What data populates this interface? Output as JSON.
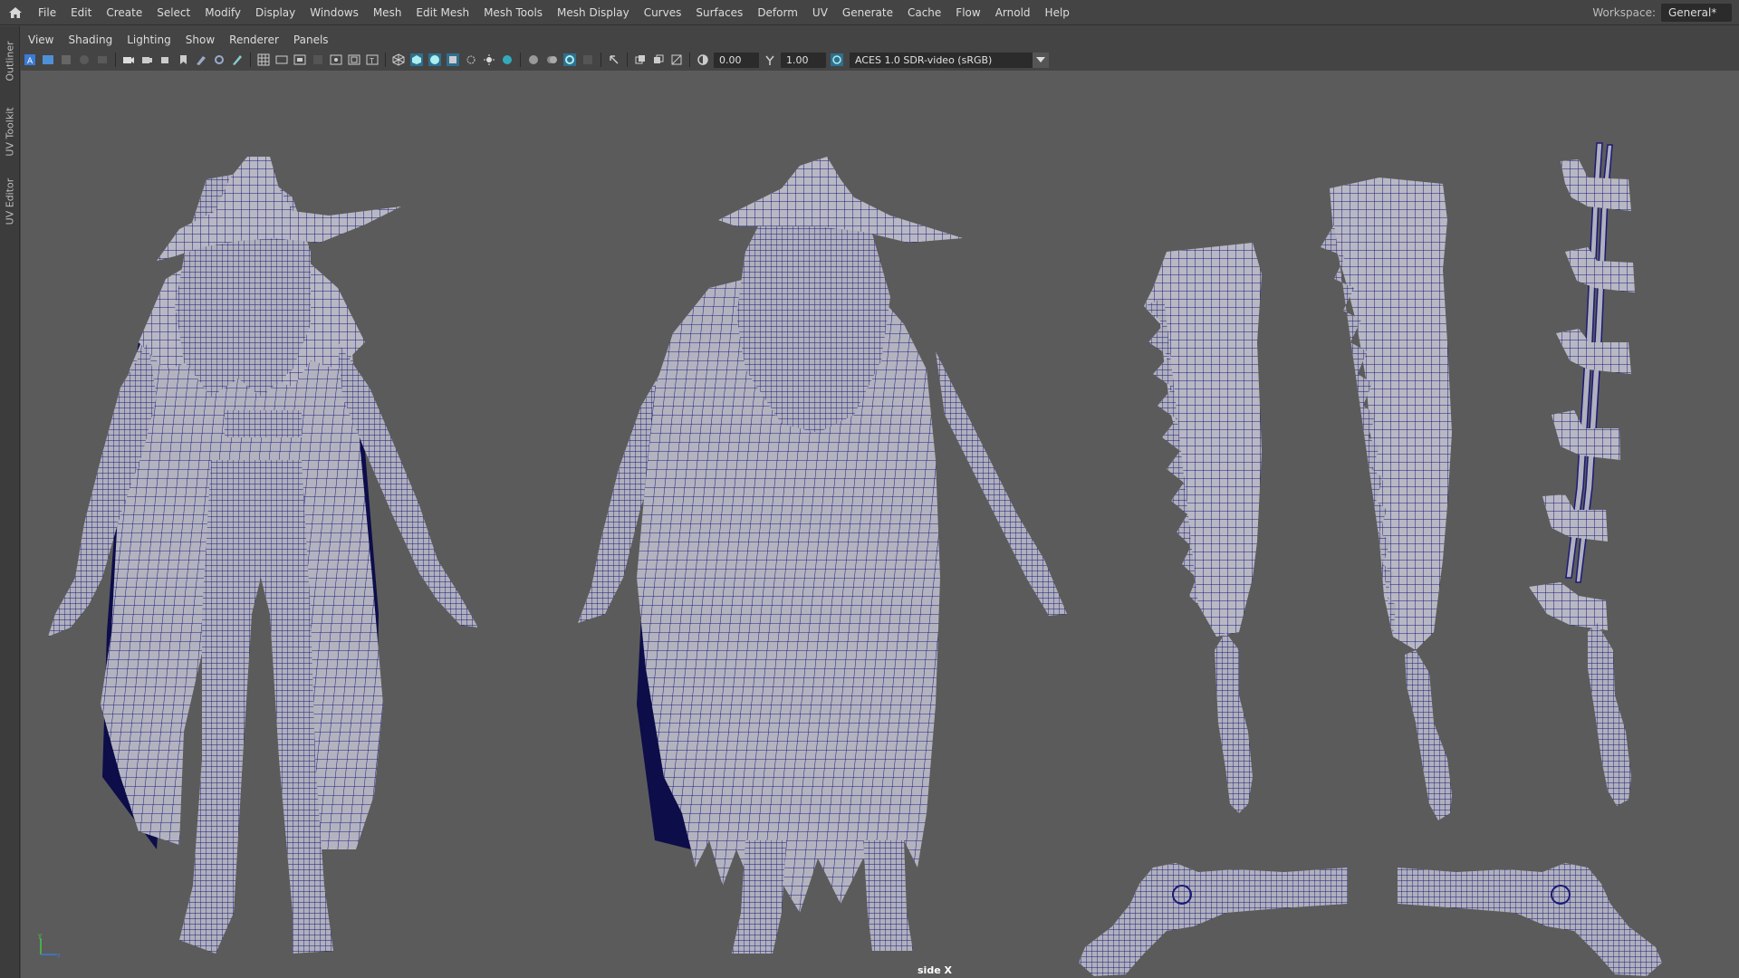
{
  "menubar": {
    "items": [
      "File",
      "Edit",
      "Create",
      "Select",
      "Modify",
      "Display",
      "Windows",
      "Mesh",
      "Edit Mesh",
      "Mesh Tools",
      "Mesh Display",
      "Curves",
      "Surfaces",
      "Deform",
      "UV",
      "Generate",
      "Cache",
      "Flow",
      "Arnold",
      "Help"
    ],
    "workspace_label": "Workspace:",
    "workspace_value": "General*"
  },
  "sidetabs": [
    "Outliner",
    "UV Toolkit",
    "UV Editor"
  ],
  "panel_menu": [
    "View",
    "Shading",
    "Lighting",
    "Show",
    "Renderer",
    "Panels"
  ],
  "toolbar": {
    "exposure": "0.00",
    "gamma": "1.00",
    "color_space": "ACES 1.0 SDR-video (sRGB)"
  },
  "viewport": {
    "camera_label": "side X",
    "background_color": "#5b5b5b",
    "wire_color": "#1a1a78",
    "shade_color": "#b9b9c4",
    "objects": [
      "hunter-character-front",
      "hunter-character-back",
      "saw-cleaver-folded",
      "saw-cleaver-side",
      "saw-cleaver-extended",
      "flintlock-pistol-left",
      "flintlock-pistol-right"
    ]
  }
}
